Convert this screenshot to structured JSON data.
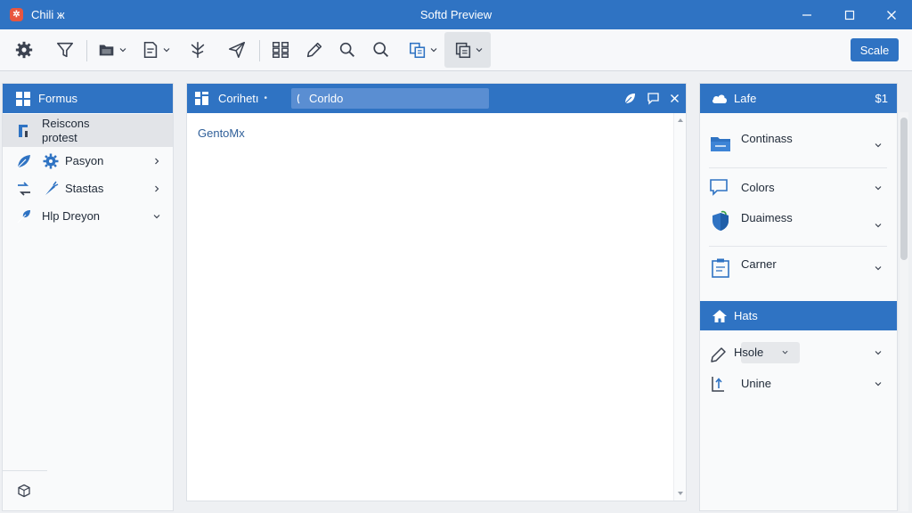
{
  "window": {
    "app_name": "Chili ж",
    "title": "Softd Preview",
    "controls": {
      "minimize": "minimize",
      "maximize": "maximize",
      "close": "close"
    }
  },
  "toolbar": {
    "tools": [
      {
        "icon": "gear-icon"
      },
      {
        "icon": "filter-icon"
      },
      {
        "icon": "folder-icon"
      },
      {
        "icon": "document-icon"
      },
      {
        "icon": "branch-icon"
      },
      {
        "icon": "send-icon"
      },
      {
        "icon": "grid-icon"
      },
      {
        "icon": "pencil-icon"
      },
      {
        "icon": "search-icon"
      },
      {
        "icon": "zoom-icon"
      },
      {
        "icon": "copy-icon"
      },
      {
        "icon": "layers-icon"
      }
    ],
    "scale_label": "Scale"
  },
  "left_panel": {
    "title": "Formus",
    "items": [
      {
        "label": "Reiscons protest",
        "selected": true
      },
      {
        "label": "Pasyon"
      },
      {
        "label": "Stastas"
      },
      {
        "label": "Hlp Dreyon"
      }
    ]
  },
  "center_panel": {
    "tab_label": "Corihetı",
    "tab_marker": "•",
    "search_value": "Corldo",
    "content_text": "GentoMx"
  },
  "right_panel": {
    "section1": {
      "title": "Lafe",
      "extra": "$1",
      "items": [
        {
          "label": "Continass"
        },
        {
          "label": "Colors"
        },
        {
          "label": "Duaimess"
        },
        {
          "label": "Carner"
        }
      ]
    },
    "section2": {
      "title": "Hats",
      "items": [
        {
          "label": "Hsole"
        },
        {
          "label": "Unine"
        }
      ]
    }
  },
  "colors": {
    "accent": "#2f73c3",
    "surface": "#f9fafb",
    "selected": "#e2e4e8"
  }
}
